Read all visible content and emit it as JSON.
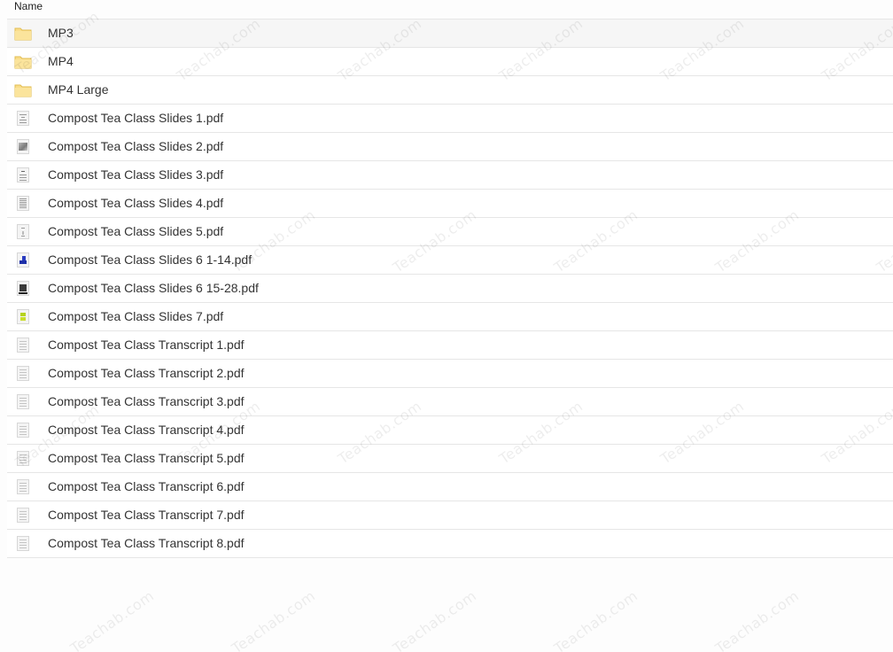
{
  "header": {
    "column_name": "Name"
  },
  "watermark_text": "Teachab.com",
  "rows": [
    {
      "label": "MP3",
      "icon": "folder-icon"
    },
    {
      "label": "MP4",
      "icon": "folder-icon"
    },
    {
      "label": "MP4 Large",
      "icon": "folder-icon"
    },
    {
      "label": "Compost Tea Class Slides 1.pdf",
      "icon": "pdf-thumbnail-icon"
    },
    {
      "label": "Compost Tea Class Slides 2.pdf",
      "icon": "pdf-thumbnail-icon"
    },
    {
      "label": "Compost Tea Class Slides 3.pdf",
      "icon": "pdf-thumbnail-icon"
    },
    {
      "label": "Compost Tea Class Slides 4.pdf",
      "icon": "pdf-thumbnail-icon"
    },
    {
      "label": "Compost Tea Class Slides 5.pdf",
      "icon": "pdf-thumbnail-icon"
    },
    {
      "label": "Compost Tea Class Slides 6 1-14.pdf",
      "icon": "pdf-thumbnail-icon"
    },
    {
      "label": "Compost Tea Class Slides 6 15-28.pdf",
      "icon": "pdf-thumbnail-icon"
    },
    {
      "label": "Compost Tea Class Slides 7.pdf",
      "icon": "pdf-thumbnail-icon"
    },
    {
      "label": "Compost Tea Class Transcript 1.pdf",
      "icon": "pdf-thumbnail-icon"
    },
    {
      "label": "Compost Tea Class Transcript 2.pdf",
      "icon": "pdf-thumbnail-icon"
    },
    {
      "label": "Compost Tea Class Transcript 3.pdf",
      "icon": "pdf-thumbnail-icon"
    },
    {
      "label": "Compost Tea Class Transcript 4.pdf",
      "icon": "pdf-thumbnail-icon"
    },
    {
      "label": "Compost Tea Class Transcript 5.pdf",
      "icon": "pdf-thumbnail-icon"
    },
    {
      "label": "Compost Tea Class Transcript 6.pdf",
      "icon": "pdf-thumbnail-icon"
    },
    {
      "label": "Compost Tea Class Transcript 7.pdf",
      "icon": "pdf-thumbnail-icon"
    },
    {
      "label": "Compost Tea Class Transcript 8.pdf",
      "icon": "pdf-thumbnail-icon"
    }
  ],
  "colors": {
    "folder_fill": "#f9dd8a",
    "folder_stroke": "#e2bd52",
    "row_border": "#e6e6e6",
    "hover_row": "#f6f6f6",
    "text": "#333333"
  }
}
